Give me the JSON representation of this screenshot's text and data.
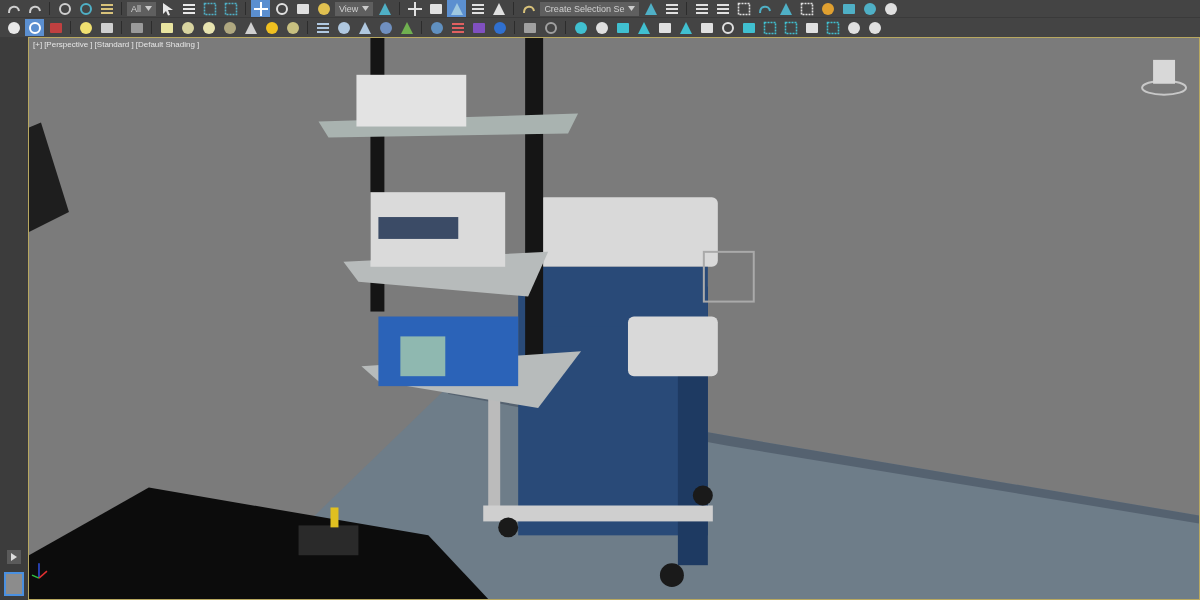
{
  "toolbar_rows": [
    {
      "items": [
        {
          "kind": "tool",
          "active": false
        },
        {
          "kind": "tool",
          "active": false
        },
        {
          "kind": "separator"
        },
        {
          "kind": "tool",
          "active": false
        },
        {
          "kind": "tool",
          "active": false
        },
        {
          "kind": "tool",
          "active": false
        },
        {
          "kind": "separator"
        },
        {
          "kind": "dropdown",
          "value": "All"
        },
        {
          "kind": "tool",
          "active": false
        },
        {
          "kind": "tool",
          "active": false
        },
        {
          "kind": "tool",
          "active": false
        },
        {
          "kind": "tool",
          "active": false
        },
        {
          "kind": "separator"
        },
        {
          "kind": "tool",
          "active": true
        },
        {
          "kind": "tool",
          "active": false
        },
        {
          "kind": "tool",
          "active": false
        },
        {
          "kind": "tool",
          "active": false
        },
        {
          "kind": "dropdown",
          "value": "View"
        },
        {
          "kind": "tool",
          "active": false
        },
        {
          "kind": "separator"
        },
        {
          "kind": "tool",
          "active": false
        },
        {
          "kind": "tool",
          "active": false
        },
        {
          "kind": "tool",
          "active": true
        },
        {
          "kind": "tool",
          "active": false
        },
        {
          "kind": "tool",
          "active": false
        },
        {
          "kind": "separator"
        },
        {
          "kind": "tool",
          "active": false
        },
        {
          "kind": "dropdown",
          "value": "Create Selection Se"
        },
        {
          "kind": "tool",
          "active": false
        },
        {
          "kind": "tool",
          "active": false
        },
        {
          "kind": "separator"
        },
        {
          "kind": "tool",
          "active": false
        },
        {
          "kind": "tool",
          "active": false
        },
        {
          "kind": "tool",
          "active": false
        },
        {
          "kind": "tool",
          "active": false
        },
        {
          "kind": "tool",
          "active": false
        },
        {
          "kind": "tool",
          "active": false
        },
        {
          "kind": "tool",
          "active": false
        },
        {
          "kind": "tool",
          "active": false
        },
        {
          "kind": "tool",
          "active": false
        },
        {
          "kind": "tool",
          "active": false
        }
      ]
    },
    {
      "items": [
        {
          "kind": "tool",
          "active": false
        },
        {
          "kind": "tool",
          "active": true
        },
        {
          "kind": "tool",
          "active": false
        },
        {
          "kind": "separator"
        },
        {
          "kind": "tool",
          "active": false
        },
        {
          "kind": "tool",
          "active": false
        },
        {
          "kind": "separator"
        },
        {
          "kind": "tool",
          "active": false
        },
        {
          "kind": "separator"
        },
        {
          "kind": "tool",
          "active": false
        },
        {
          "kind": "tool",
          "active": false
        },
        {
          "kind": "tool",
          "active": false
        },
        {
          "kind": "tool",
          "active": false
        },
        {
          "kind": "tool",
          "active": false
        },
        {
          "kind": "tool",
          "active": false
        },
        {
          "kind": "tool",
          "active": false
        },
        {
          "kind": "separator"
        },
        {
          "kind": "tool",
          "active": false
        },
        {
          "kind": "tool",
          "active": false
        },
        {
          "kind": "tool",
          "active": false
        },
        {
          "kind": "tool",
          "active": false
        },
        {
          "kind": "tool",
          "active": false
        },
        {
          "kind": "separator"
        },
        {
          "kind": "tool",
          "active": false
        },
        {
          "kind": "tool",
          "active": false
        },
        {
          "kind": "tool",
          "active": false
        },
        {
          "kind": "tool",
          "active": false
        },
        {
          "kind": "separator"
        },
        {
          "kind": "tool",
          "active": false
        },
        {
          "kind": "tool",
          "active": false
        },
        {
          "kind": "separator"
        },
        {
          "kind": "tool",
          "active": false
        },
        {
          "kind": "tool",
          "active": false
        },
        {
          "kind": "tool",
          "active": false
        },
        {
          "kind": "tool",
          "active": false
        },
        {
          "kind": "tool",
          "active": false
        },
        {
          "kind": "tool",
          "active": false
        },
        {
          "kind": "tool",
          "active": false
        },
        {
          "kind": "tool",
          "active": false
        },
        {
          "kind": "tool",
          "active": false
        },
        {
          "kind": "tool",
          "active": false
        },
        {
          "kind": "tool",
          "active": false
        },
        {
          "kind": "tool",
          "active": false
        },
        {
          "kind": "tool",
          "active": false
        },
        {
          "kind": "tool",
          "active": false
        },
        {
          "kind": "tool",
          "active": false
        }
      ]
    }
  ],
  "viewport": {
    "labels": [
      "[+]",
      "[Perspective ]",
      "[Standard ]",
      "[Default Shading ]"
    ]
  }
}
